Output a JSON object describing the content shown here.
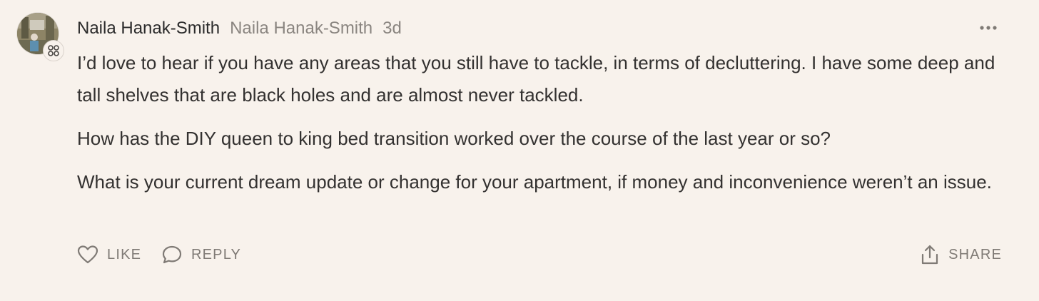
{
  "comment": {
    "author_name": "Naila Hanak-Smith",
    "handle": "Naila Hanak-Smith",
    "time": "3d",
    "paragraphs": [
      "I’d love to hear if you have any areas that you still have to tackle, in terms of decluttering. I have some deep and tall shelves that are black holes and are almost never tackled.",
      "How has the DIY queen to king bed transition worked over the course of the last year or so?",
      "What is your current dream update or change for your apartment, if money and inconvenience weren’t an issue."
    ]
  },
  "actions": {
    "like_label": "LIKE",
    "reply_label": "REPLY",
    "share_label": "SHARE"
  },
  "icons": {
    "avatar": "avatar-photo",
    "badge": "subscriber-badge-icon",
    "more": "more-options-icon",
    "like": "heart-icon",
    "reply": "speech-bubble-icon",
    "share": "share-icon"
  },
  "colors": {
    "background": "#f8f2ec",
    "text": "#333130",
    "muted": "#8a8580"
  }
}
